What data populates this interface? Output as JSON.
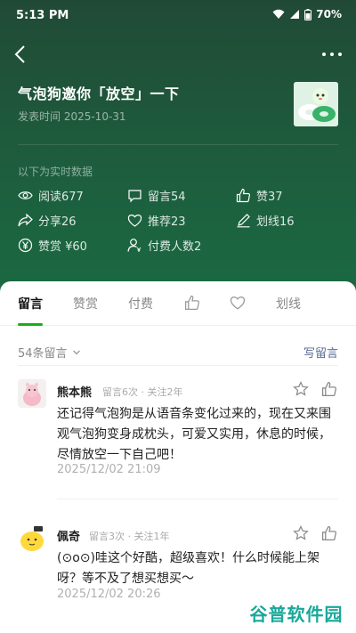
{
  "status_bar": {
    "time": "5:13 PM",
    "battery": "70%"
  },
  "article": {
    "title": "气泡狗邀你「放空」一下",
    "publish_time": "发表时间 2025-10-31"
  },
  "realtime_label": "以下为实时数据",
  "stats": {
    "reads": "阅读677",
    "comments": "留言54",
    "likes": "赞37",
    "shares": "分享26",
    "recommends": "推荐23",
    "highlights": "划线16",
    "tips": "赞赏 ¥60",
    "payers": "付费人数2"
  },
  "tabs": {
    "comments": "留言",
    "tips": "赞赏",
    "paid": "付费",
    "likes_icon": "thumbs-up-icon",
    "favorites_icon": "heart-icon",
    "highlights": "划线"
  },
  "section": {
    "count": "54条留言",
    "write": "写留言"
  },
  "comments": [
    {
      "name": "熊本熊",
      "meta": "留言6次 · 关注2年",
      "text": "还记得气泡狗是从语音条变化过来的，现在又来围观气泡狗变身成枕头，可爱又实用，休息的时候，尽情放空一下自己吧！",
      "date": "2025/12/02 21:09"
    },
    {
      "name": "佩奇",
      "meta": "留言3次 · 关注1年",
      "text": "(⊙o⊙)哇这个好酷，超级喜欢！什么时候能上架呀？等不及了想买想买～",
      "date": "2025/12/02 20:26"
    }
  ],
  "watermark": "谷普软件园",
  "colors": {
    "header_bg": "#1e5a3c",
    "accent": "#1aad19",
    "link": "#576b95"
  }
}
